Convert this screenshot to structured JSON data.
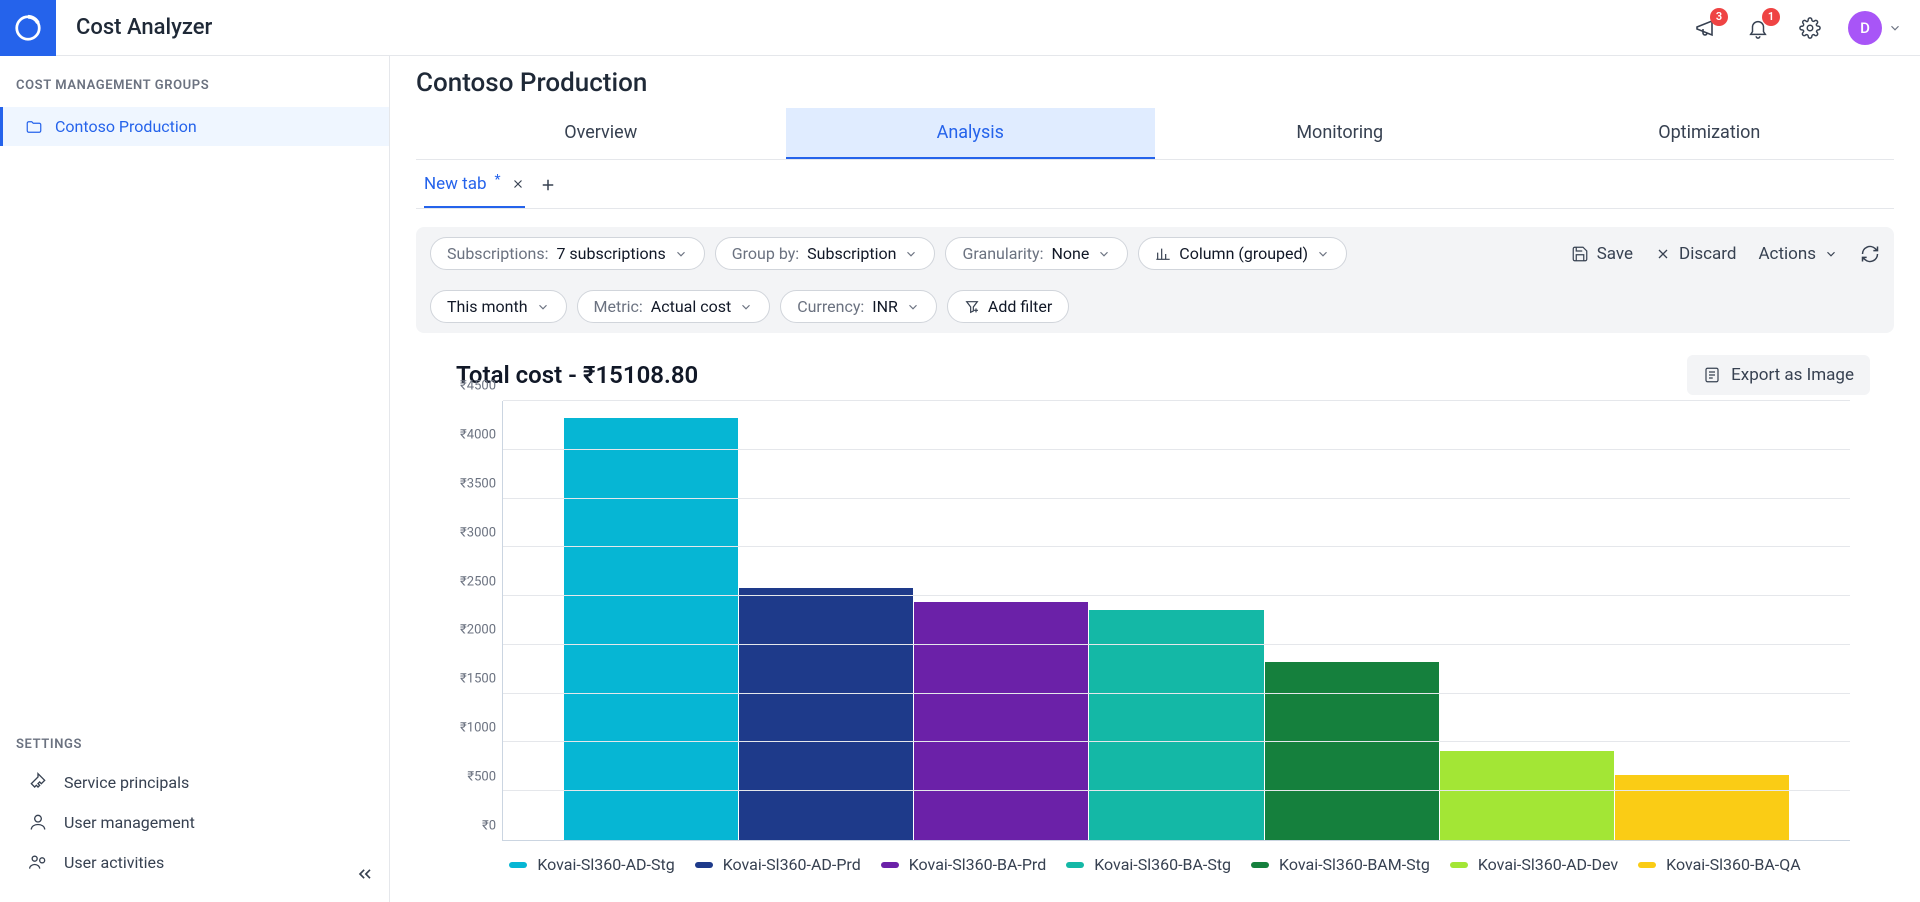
{
  "header": {
    "app_title": "Cost Analyzer",
    "announce_badge": "3",
    "notify_badge": "1",
    "avatar_initial": "D"
  },
  "sidebar": {
    "heading": "COST MANAGEMENT GROUPS",
    "tree_item": "Contoso Production",
    "settings_heading": "SETTINGS",
    "settings": {
      "sp": "Service principals",
      "um": "User management",
      "ua": "User activities"
    }
  },
  "page": {
    "title": "Contoso Production",
    "tabs": {
      "overview": "Overview",
      "analysis": "Analysis",
      "monitoring": "Monitoring",
      "optimization": "Optimization"
    },
    "subtab": "New tab"
  },
  "filters": {
    "subscriptions": {
      "label": "Subscriptions:",
      "value": "7 subscriptions"
    },
    "groupby": {
      "label": "Group by:",
      "value": "Subscription"
    },
    "granularity": {
      "label": "Granularity:",
      "value": "None"
    },
    "viz": "Column (grouped)",
    "period": "This month",
    "metric": {
      "label": "Metric:",
      "value": "Actual cost"
    },
    "currency": {
      "label": "Currency:",
      "value": "INR"
    },
    "add_filter": "Add filter",
    "actions": {
      "save": "Save",
      "discard": "Discard",
      "actions": "Actions"
    }
  },
  "chart": {
    "title": "Total cost - ₹15108.80",
    "export": "Export as Image"
  },
  "chart_data": {
    "type": "bar",
    "ylabel": "",
    "xlabel": "",
    "ylim": [
      0,
      4500
    ],
    "y_ticks": [
      "₹0",
      "₹500",
      "₹1000",
      "₹1500",
      "₹2000",
      "₹2500",
      "₹3000",
      "₹3500",
      "₹4000",
      "₹4500"
    ],
    "categories": [
      "Kovai-Sl360-AD-Stg",
      "Kovai-Sl360-AD-Prd",
      "Kovai-Sl360-BA-Prd",
      "Kovai-Sl360-BA-Stg",
      "Kovai-Sl360-BAM-Stg",
      "Kovai-Sl360-AD-Dev",
      "Kovai-Sl360-BA-QA"
    ],
    "values": [
      4330,
      2580,
      2440,
      2360,
      1820,
      910,
      670
    ],
    "colors": [
      "#06b6d4",
      "#1e3a8a",
      "#6b21a8",
      "#14b8a6",
      "#15803d",
      "#a3e635",
      "#facc15"
    ]
  }
}
